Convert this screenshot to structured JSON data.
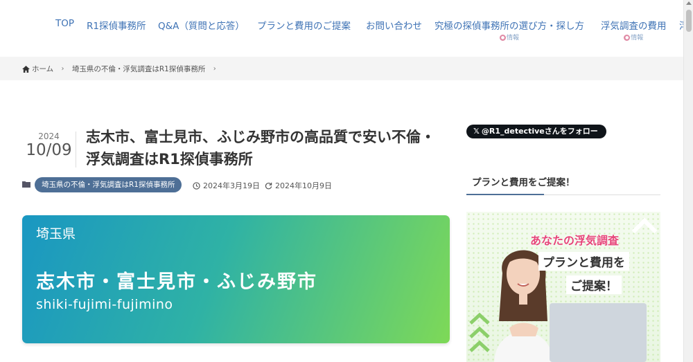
{
  "nav": {
    "items": [
      {
        "label": "TOP"
      },
      {
        "label": "R1探偵事務所"
      },
      {
        "label": "Q&A（質問と応答）"
      },
      {
        "label": "プランと費用のご提案"
      },
      {
        "label": "お問い合わせ"
      },
      {
        "label": "究極の探偵事務所の選び方・探し方",
        "sub": "情報"
      },
      {
        "label": "浮気調査の費用",
        "sub": "情報"
      },
      {
        "label": "浮"
      }
    ]
  },
  "breadcrumb": {
    "home": "ホーム",
    "category": "埼玉県の不倫・浮気調査はR1探偵事務所"
  },
  "article": {
    "year": "2024",
    "month_day": "10/09",
    "title": "志木市、富士見市、ふじみ野市の高品質で安い不倫・浮気調査はR1探偵事務所",
    "category_badge": "埼玉県の不倫・浮気調査はR1探偵事務所",
    "published": "2024年3月19日",
    "updated": "2024年10月9日",
    "hero": {
      "prefecture": "埼玉県",
      "cities": "志木市・富士見市・ふじみ野市",
      "romanized": "shiki-fujimi-fujimino"
    }
  },
  "sidebar": {
    "follow_label": "@R1_detectiveさんをフォロー",
    "heading": "プランと費用をご提案！",
    "banner": {
      "line1": "あなたの浮気調査",
      "line2": "プランと費用を",
      "line3": "ご提案！"
    }
  },
  "colors": {
    "nav_link": "#3f73b5",
    "badge_bg": "#4e6f96",
    "hero_gradient_start": "#1a97c2",
    "hero_gradient_end": "#7ed957",
    "banner_accent": "#e6467a"
  }
}
